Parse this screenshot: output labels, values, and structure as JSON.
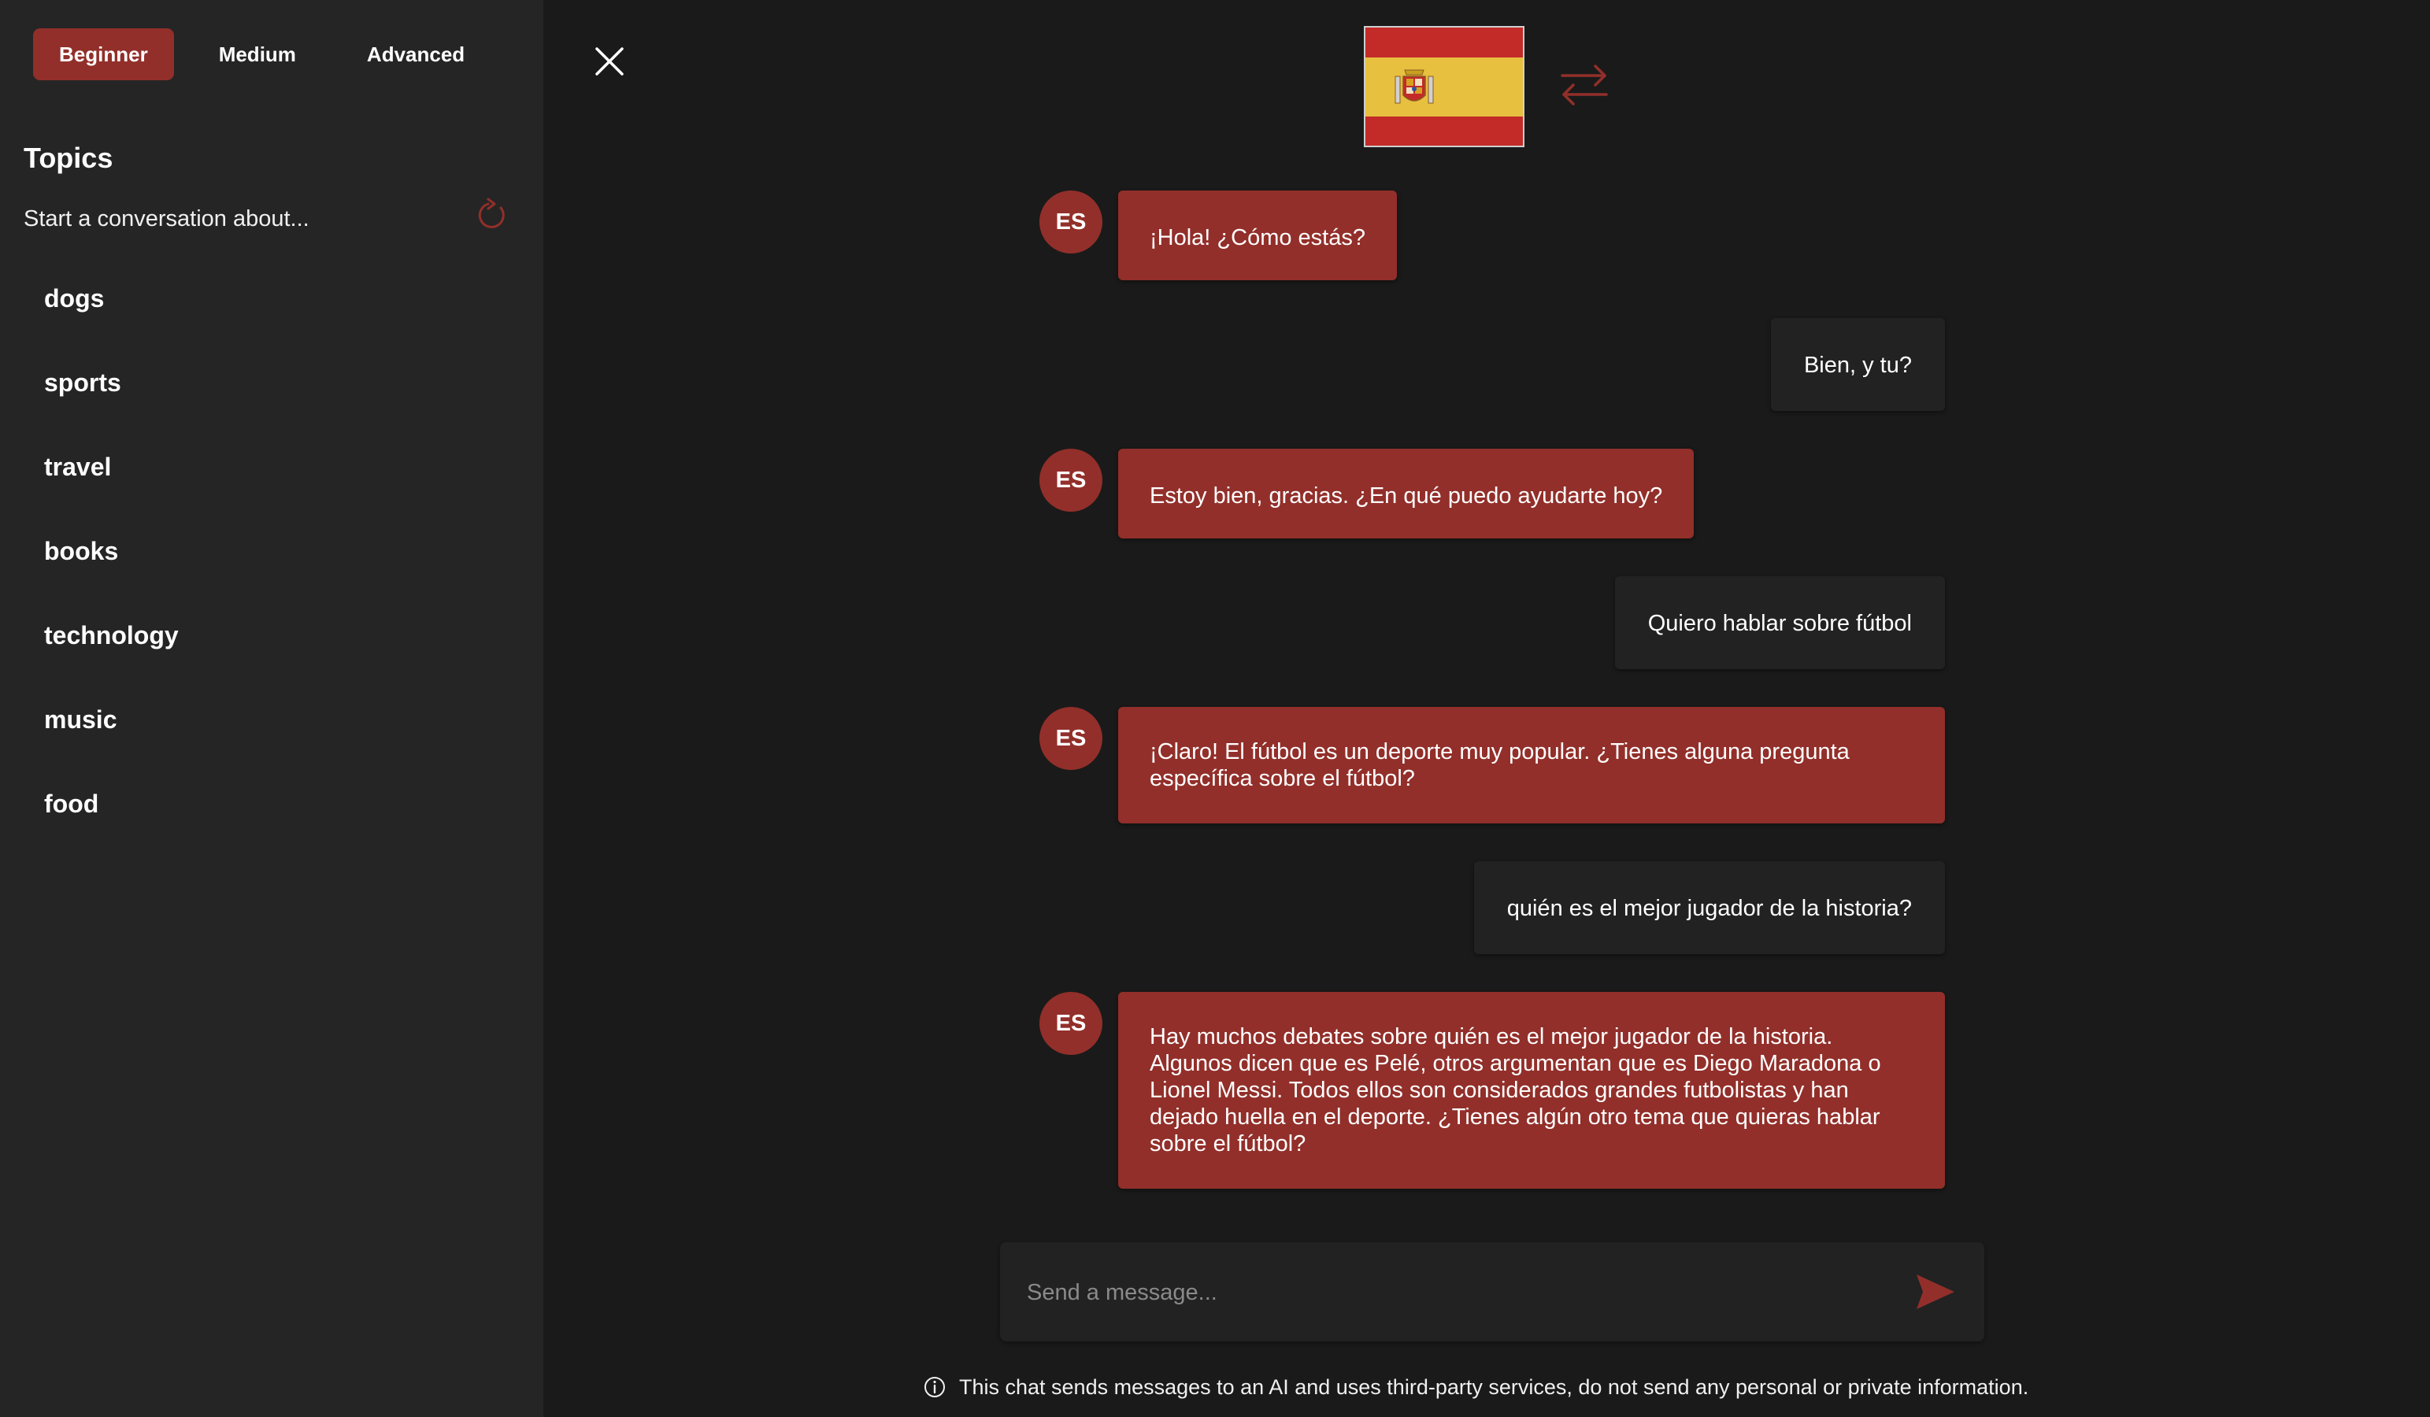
{
  "levels": {
    "items": [
      {
        "label": "Beginner",
        "active": true
      },
      {
        "label": "Medium",
        "active": false
      },
      {
        "label": "Advanced",
        "active": false
      }
    ]
  },
  "sidebar": {
    "title": "Topics",
    "subtitle": "Start a conversation about...",
    "refresh_icon": "refresh-icon",
    "topics": [
      "dogs",
      "sports",
      "travel",
      "books",
      "technology",
      "music",
      "food"
    ]
  },
  "header": {
    "close_icon": "close-icon",
    "flag_icon": "spain-flag-icon",
    "swap_icon": "swap-arrows-icon"
  },
  "messages": [
    {
      "role": "bot",
      "avatar": "ES",
      "text": "¡Hola! ¿Cómo estás?"
    },
    {
      "role": "user",
      "text": "Bien, y tu?"
    },
    {
      "role": "bot",
      "avatar": "ES",
      "text": "Estoy bien, gracias. ¿En qué puedo ayudarte hoy?"
    },
    {
      "role": "user",
      "text": "Quiero hablar sobre fútbol"
    },
    {
      "role": "bot",
      "avatar": "ES",
      "text": "¡Claro! El fútbol es un deporte muy popular. ¿Tienes alguna pregunta específica sobre el fútbol?"
    },
    {
      "role": "user",
      "text": "quién es el mejor jugador de la historia?"
    },
    {
      "role": "bot",
      "avatar": "ES",
      "text": "Hay muchos debates sobre quién es el mejor jugador de la historia. Algunos dicen que es Pelé, otros argumentan que es Diego Maradona o Lionel Messi. Todos ellos son considerados grandes futbolistas y han dejado huella en el deporte. ¿Tienes algún otro tema que quieras hablar sobre el fútbol?"
    }
  ],
  "composer": {
    "placeholder": "Send a message...",
    "value": "",
    "send_icon": "send-icon"
  },
  "footer": {
    "disclaimer": "This chat sends messages to an AI and uses third-party services, do not send any personal or private information.",
    "info_icon": "info-icon"
  },
  "colors": {
    "accent": "#922f2a",
    "background": "#1a1a1a",
    "sidebar": "#252525",
    "user_bubble": "#222222"
  }
}
